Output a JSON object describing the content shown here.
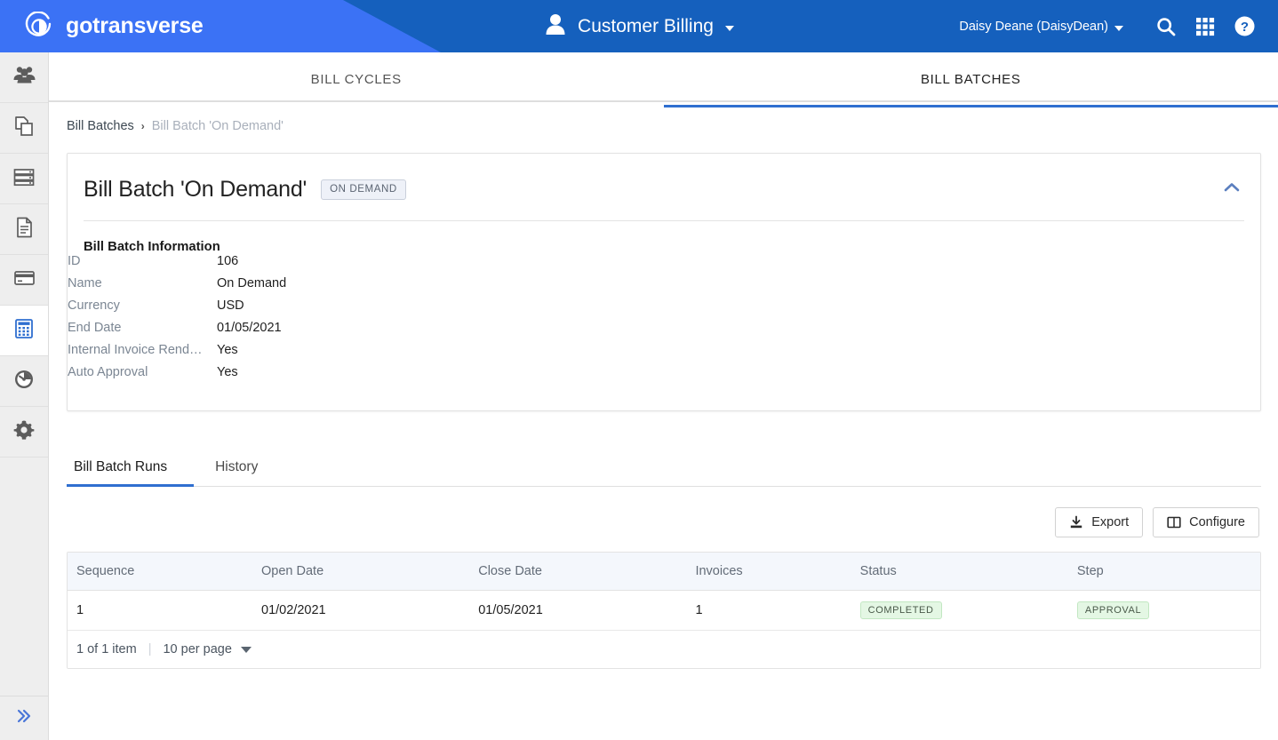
{
  "header": {
    "brand_name": "gotransverse",
    "brand_logo_icon": "circle-swirl-logo-icon",
    "center_title": "Customer Billing",
    "center_icon": "person-icon",
    "user_label": "Daisy Deane (DaisyDean)",
    "search_icon": "search-icon",
    "apps_icon": "grid-apps-icon",
    "help_icon": "help-circle-icon",
    "bg_color": "#1560bd",
    "accent_color": "#3b72f5"
  },
  "sidebar": {
    "items": [
      {
        "icon": "users-group-icon",
        "active": false
      },
      {
        "icon": "copy-documents-icon",
        "active": false
      },
      {
        "icon": "server-rack-icon",
        "active": false
      },
      {
        "icon": "document-file-icon",
        "active": false
      },
      {
        "icon": "credit-card-icon",
        "active": false
      },
      {
        "icon": "calculator-icon",
        "active": true
      },
      {
        "icon": "gauge-dashboard-icon",
        "active": false
      },
      {
        "icon": "gear-settings-icon",
        "active": false
      }
    ],
    "expand_icon": "chevron-double-right-icon"
  },
  "top_tabs": [
    {
      "label": "BILL CYCLES",
      "active": false
    },
    {
      "label": "BILL BATCHES",
      "active": true
    }
  ],
  "breadcrumb": {
    "root": "Bill Batches",
    "separator": "›",
    "current": "Bill Batch 'On Demand'"
  },
  "detail_card": {
    "title": "Bill Batch 'On Demand'",
    "badge": "ON DEMAND",
    "collapse_icon": "chevron-up-icon",
    "section_title": "Bill Batch Information",
    "fields": [
      {
        "label": "ID",
        "value": "106"
      },
      {
        "label": "Name",
        "value": "On Demand"
      },
      {
        "label": "Currency",
        "value": "USD"
      },
      {
        "label": "End Date",
        "value": "01/05/2021"
      },
      {
        "label": "Internal Invoice Rend…",
        "value": "Yes"
      },
      {
        "label": "Auto Approval",
        "value": "Yes"
      }
    ]
  },
  "sub_tabs": [
    {
      "label": "Bill Batch Runs",
      "active": true
    },
    {
      "label": "History",
      "active": false
    }
  ],
  "toolbar": {
    "export_label": "Export",
    "export_icon": "download-icon",
    "configure_label": "Configure",
    "configure_icon": "columns-layout-icon"
  },
  "grid": {
    "columns": [
      "Sequence",
      "Open Date",
      "Close Date",
      "Invoices",
      "Status",
      "Step"
    ],
    "rows": [
      {
        "sequence": "1",
        "open_date": "01/02/2021",
        "close_date": "01/05/2021",
        "invoices": "1",
        "status": "COMPLETED",
        "step": "APPROVAL"
      }
    ],
    "pager": {
      "count_label": "1 of 1 item",
      "page_size_label": "10 per page",
      "chevron_icon": "chevron-down-icon"
    }
  }
}
